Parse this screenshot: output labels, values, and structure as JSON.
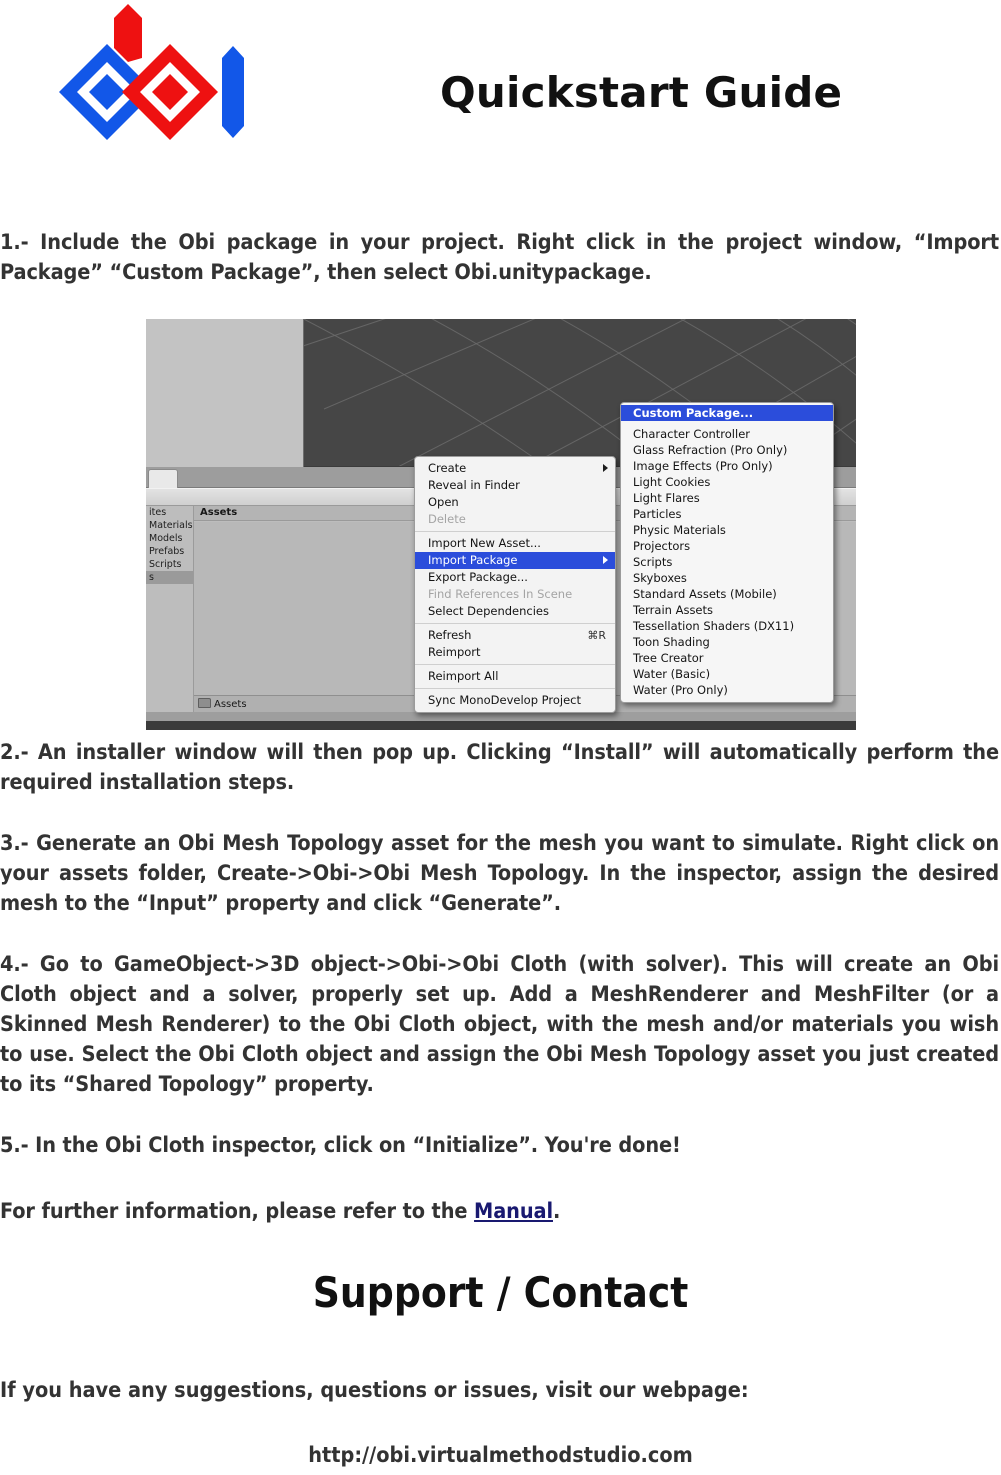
{
  "header": {
    "title": "Quickstart Guide",
    "logo_name": "obi-logo",
    "logo_colors": {
      "blue": "#1257E8",
      "red": "#EE1111"
    }
  },
  "steps": [
    {
      "id": "step-1",
      "text": "1.- Include the Obi package in your project. Right click in the project window, “Import Package”    “Custom Package”, then select Obi.unitypackage."
    },
    {
      "id": "step-2",
      "text": "2.- An installer window will then pop up. Clicking “Install” will automatically perform the required installation steps."
    },
    {
      "id": "step-3",
      "text": "3.- Generate an Obi Mesh Topology asset for the mesh you want to simulate. Right click on your assets folder, Create->Obi->Obi Mesh Topology. In the inspector, assign the desired mesh to the “Input” property and click “Generate”."
    },
    {
      "id": "step-4",
      "text": "4.- Go to GameObject->3D object->Obi->Obi Cloth (with solver). This will create an Obi Cloth object and a solver, properly set up. Add a MeshRenderer and MeshFilter (or a Skinned Mesh Renderer) to the Obi Cloth object, with the mesh and/or materials you wish to use. Select the Obi Cloth object and assign the Obi Mesh Topology asset you just created to its “Shared Topology” property."
    },
    {
      "id": "step-5",
      "text": "5.- In the Obi Cloth inspector, click on “Initialize”. You're done!"
    }
  ],
  "further": {
    "prefix": "For further information, please refer to the ",
    "link_label": "Manual",
    "suffix": ".",
    "link_color": "#191970"
  },
  "screenshot": {
    "project_panel": {
      "favorites_rows": [
        "ites",
        "Materials",
        "Models",
        "Prefabs",
        "Scripts",
        "s"
      ],
      "selected_row_index": 5,
      "assets_header": "Assets",
      "breadcrumb": "Assets"
    },
    "context_menu": {
      "items": [
        {
          "label": "Create",
          "state": "normal",
          "submenu": true
        },
        {
          "label": "Reveal in Finder",
          "state": "normal",
          "submenu": false
        },
        {
          "label": "Open",
          "state": "normal",
          "submenu": false
        },
        {
          "label": "Delete",
          "state": "disabled",
          "submenu": false
        },
        {
          "separator": true
        },
        {
          "label": "Import New Asset...",
          "state": "normal",
          "submenu": false
        },
        {
          "label": "Import Package",
          "state": "selected",
          "submenu": true
        },
        {
          "label": "Export Package...",
          "state": "normal",
          "submenu": false
        },
        {
          "label": "Find References In Scene",
          "state": "disabled",
          "submenu": false
        },
        {
          "label": "Select Dependencies",
          "state": "normal",
          "submenu": false
        },
        {
          "separator": true
        },
        {
          "label": "Refresh",
          "state": "normal",
          "submenu": false,
          "shortcut": "⌘R"
        },
        {
          "label": "Reimport",
          "state": "normal",
          "submenu": false
        },
        {
          "separator": true
        },
        {
          "label": "Reimport All",
          "state": "normal",
          "submenu": false
        },
        {
          "separator": true
        },
        {
          "label": "Sync MonoDevelop Project",
          "state": "normal",
          "submenu": false
        }
      ],
      "highlight_color": "#2b4ddb"
    },
    "import_package_submenu": {
      "items": [
        {
          "label": "Custom Package...",
          "state": "selected"
        },
        {
          "gap": true
        },
        {
          "label": "Character Controller",
          "state": "normal"
        },
        {
          "label": "Glass Refraction (Pro Only)",
          "state": "normal"
        },
        {
          "label": "Image Effects (Pro Only)",
          "state": "normal"
        },
        {
          "label": "Light Cookies",
          "state": "normal"
        },
        {
          "label": "Light Flares",
          "state": "normal"
        },
        {
          "label": "Particles",
          "state": "normal"
        },
        {
          "label": "Physic Materials",
          "state": "normal"
        },
        {
          "label": "Projectors",
          "state": "normal"
        },
        {
          "label": "Scripts",
          "state": "normal"
        },
        {
          "label": "Skyboxes",
          "state": "normal"
        },
        {
          "label": "Standard Assets (Mobile)",
          "state": "normal"
        },
        {
          "label": "Terrain Assets",
          "state": "normal"
        },
        {
          "label": "Tessellation Shaders (DX11)",
          "state": "normal"
        },
        {
          "label": "Toon Shading",
          "state": "normal"
        },
        {
          "label": "Tree Creator",
          "state": "normal"
        },
        {
          "label": "Water (Basic)",
          "state": "normal"
        },
        {
          "label": "Water (Pro Only)",
          "state": "normal"
        }
      ],
      "highlight_color": "#2b4ddb"
    }
  },
  "support": {
    "title": "Support / Contact",
    "line": "If you have any suggestions, questions or issues, visit our webpage:",
    "url": "http://obi.virtualmethodstudio.com"
  }
}
